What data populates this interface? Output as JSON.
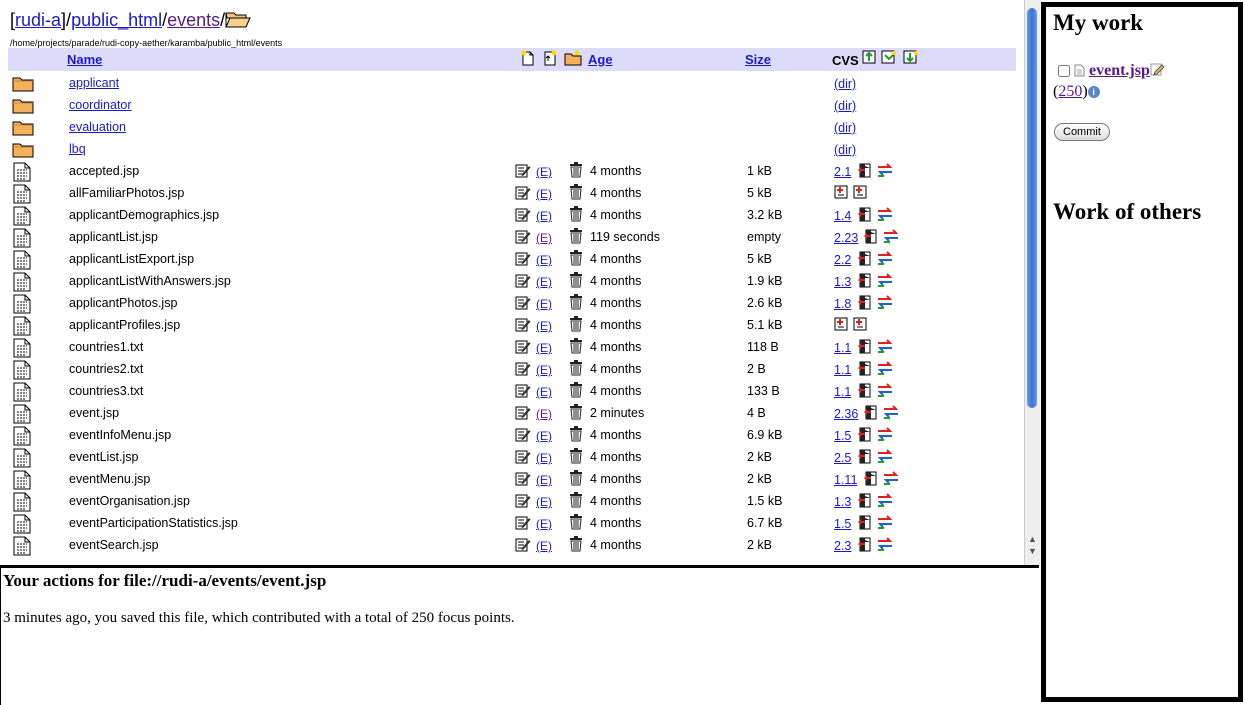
{
  "breadcrumb": {
    "root": "rudi-a",
    "sep1": "]/",
    "dir1": "public_html",
    "sep2": "/",
    "dir2": "events",
    "sep3": "/",
    "open": "["
  },
  "path": "/home/projects/parade/rudi-copy-aether/karamba/public_html/events",
  "columns": {
    "name": "Name",
    "age": "Age",
    "size": "Size",
    "cvs": "CVS"
  },
  "folders": [
    {
      "name": "applicant",
      "cvs": "(dir)"
    },
    {
      "name": "coordinator",
      "cvs": "(dir)"
    },
    {
      "name": "evaluation",
      "cvs": "(dir)"
    },
    {
      "name": "lbq",
      "cvs": "(dir)"
    }
  ],
  "edit_label": "(E)",
  "files": [
    {
      "name": "accepted.jsp",
      "age": "4 months",
      "size": "1 kB",
      "cvs": "2.1"
    },
    {
      "name": "allFamiliarPhotos.jsp",
      "age": "4 months",
      "size": "5 kB",
      "cvs": ""
    },
    {
      "name": "applicantDemographics.jsp",
      "age": "4 months",
      "size": "3.2 kB",
      "cvs": "1.4"
    },
    {
      "name": "applicantList.jsp",
      "age": "119 seconds",
      "size": "empty",
      "cvs": "2.23"
    },
    {
      "name": "applicantListExport.jsp",
      "age": "4 months",
      "size": "5 kB",
      "cvs": "2.2"
    },
    {
      "name": "applicantListWithAnswers.jsp",
      "age": "4 months",
      "size": "1.9 kB",
      "cvs": "1.3"
    },
    {
      "name": "applicantPhotos.jsp",
      "age": "4 months",
      "size": "2.6 kB",
      "cvs": "1.8"
    },
    {
      "name": "applicantProfiles.jsp",
      "age": "4 months",
      "size": "5.1 kB",
      "cvs": ""
    },
    {
      "name": "countries1.txt",
      "age": "4 months",
      "size": "118 B",
      "cvs": "1.1"
    },
    {
      "name": "countries2.txt",
      "age": "4 months",
      "size": "2 B",
      "cvs": "1.1"
    },
    {
      "name": "countries3.txt",
      "age": "4 months",
      "size": "133 B",
      "cvs": "1.1"
    },
    {
      "name": "event.jsp",
      "age": "2 minutes",
      "size": "4 B",
      "cvs": "2.36"
    },
    {
      "name": "eventInfoMenu.jsp",
      "age": "4 months",
      "size": "6.9 kB",
      "cvs": "1.5"
    },
    {
      "name": "eventList.jsp",
      "age": "4 months",
      "size": "2 kB",
      "cvs": "2.5"
    },
    {
      "name": "eventMenu.jsp",
      "age": "4 months",
      "size": "2 kB",
      "cvs": "1.11"
    },
    {
      "name": "eventOrganisation.jsp",
      "age": "4 months",
      "size": "1.5 kB",
      "cvs": "1.3"
    },
    {
      "name": "eventParticipationStatistics.jsp",
      "age": "4 months",
      "size": "6.7 kB",
      "cvs": "1.5"
    },
    {
      "name": "eventSearch.jsp",
      "age": "4 months",
      "size": "2 kB",
      "cvs": "2.3"
    }
  ],
  "actions": {
    "title": "Your actions for file://rudi-a/events/event.jsp",
    "text": "3 minutes ago, you saved this file, which contributed with a total of 250 focus points."
  },
  "right": {
    "mywork_title": "My work",
    "item_file": "event.jsp",
    "points_open": "(",
    "points": "250",
    "points_close": ")",
    "commit_label": "Commit",
    "others_title": "Work of others"
  },
  "colors": {
    "header_bg": "#dcdcfa",
    "link": "#1a1acc",
    "visited": "#551a8b",
    "folder": "#f4b15a"
  }
}
